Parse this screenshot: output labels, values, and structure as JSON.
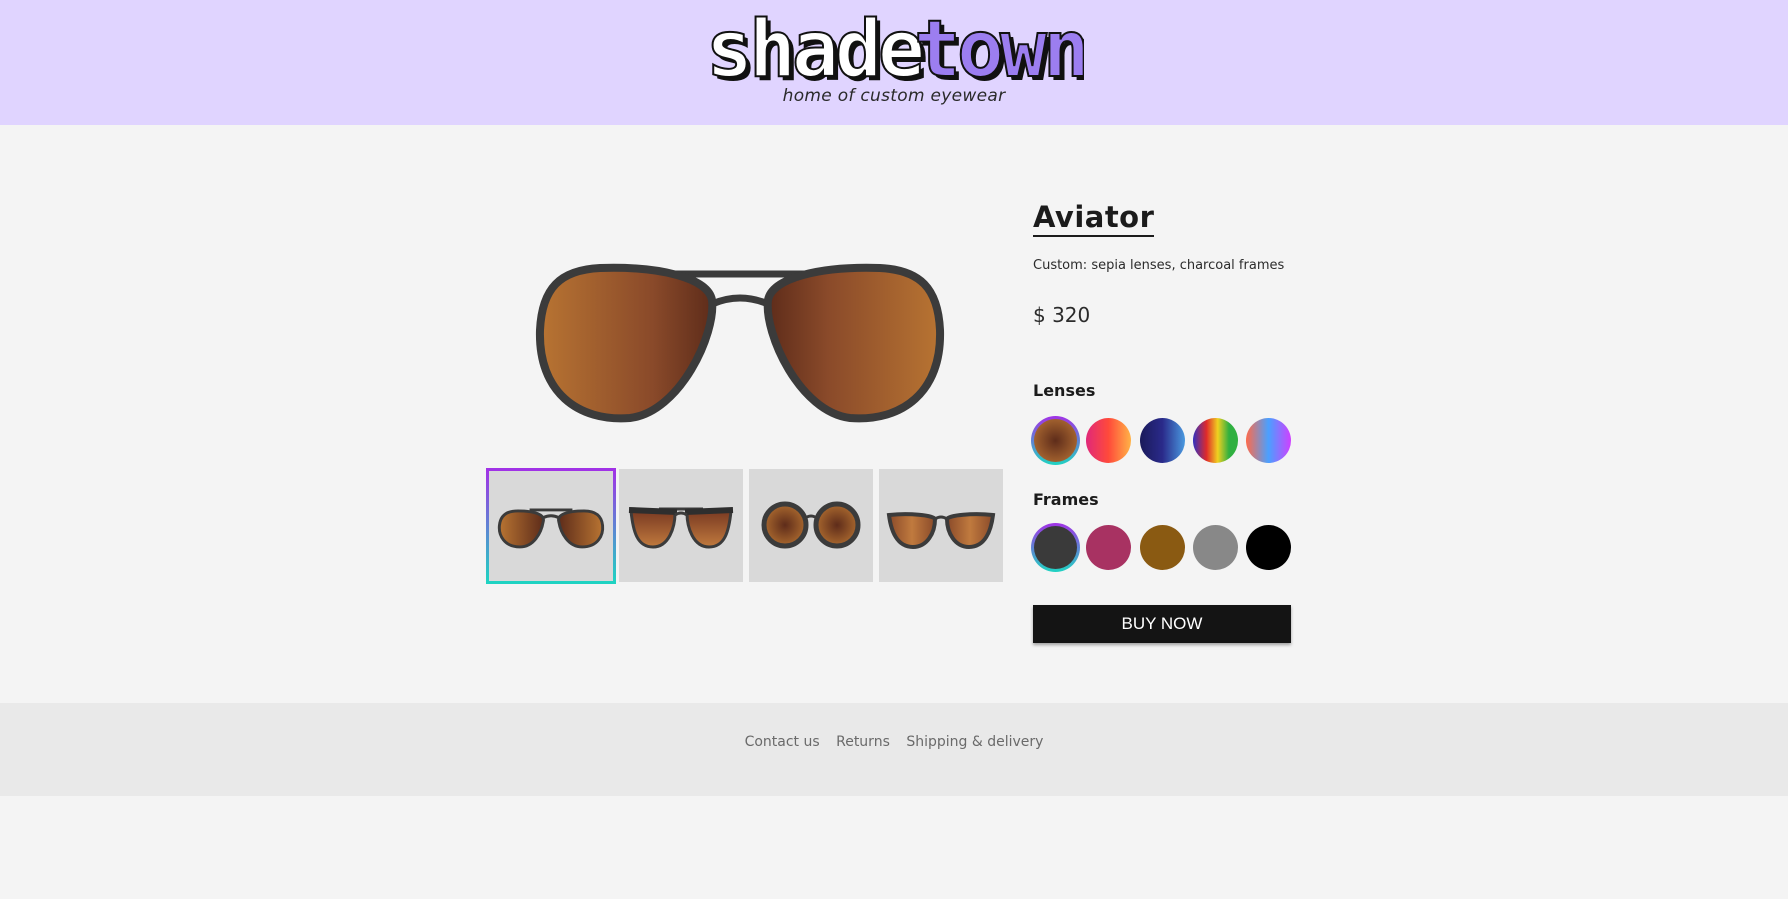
{
  "brand": {
    "name_part1": "shade",
    "name_part2": "town",
    "tagline": "home of custom eyewear",
    "accent_color": "#9c7ef0",
    "header_bg": "#e0d4ff"
  },
  "product": {
    "title": "Aviator",
    "custom_description": "Custom: sepia lenses, charcoal frames",
    "price": "$ 320",
    "main_image_icon": "aviator-sunglasses-icon",
    "thumbnails": [
      {
        "name": "aviator-thumb",
        "selected": true
      },
      {
        "name": "browline-thumb",
        "selected": false
      },
      {
        "name": "round-thumb",
        "selected": false
      },
      {
        "name": "cat-eye-thumb",
        "selected": false
      }
    ]
  },
  "options": {
    "lenses_label": "Lenses",
    "frames_label": "Frames",
    "lenses": [
      {
        "name": "sepia",
        "selected": true
      },
      {
        "name": "sunset",
        "selected": false
      },
      {
        "name": "midnight",
        "selected": false
      },
      {
        "name": "rainbow",
        "selected": false
      },
      {
        "name": "iridescent",
        "selected": false
      }
    ],
    "frames": [
      {
        "name": "charcoal",
        "color": "#3a3a3a",
        "selected": true
      },
      {
        "name": "raspberry",
        "color": "#a83262",
        "selected": false
      },
      {
        "name": "bronze",
        "color": "#8a5a12",
        "selected": false
      },
      {
        "name": "grey",
        "color": "#888888",
        "selected": false
      },
      {
        "name": "black",
        "color": "#000000",
        "selected": false
      }
    ]
  },
  "buy_button": {
    "label": "BUY NOW"
  },
  "footer": {
    "links": [
      "Contact us",
      "Returns",
      "Shipping & delivery"
    ]
  }
}
